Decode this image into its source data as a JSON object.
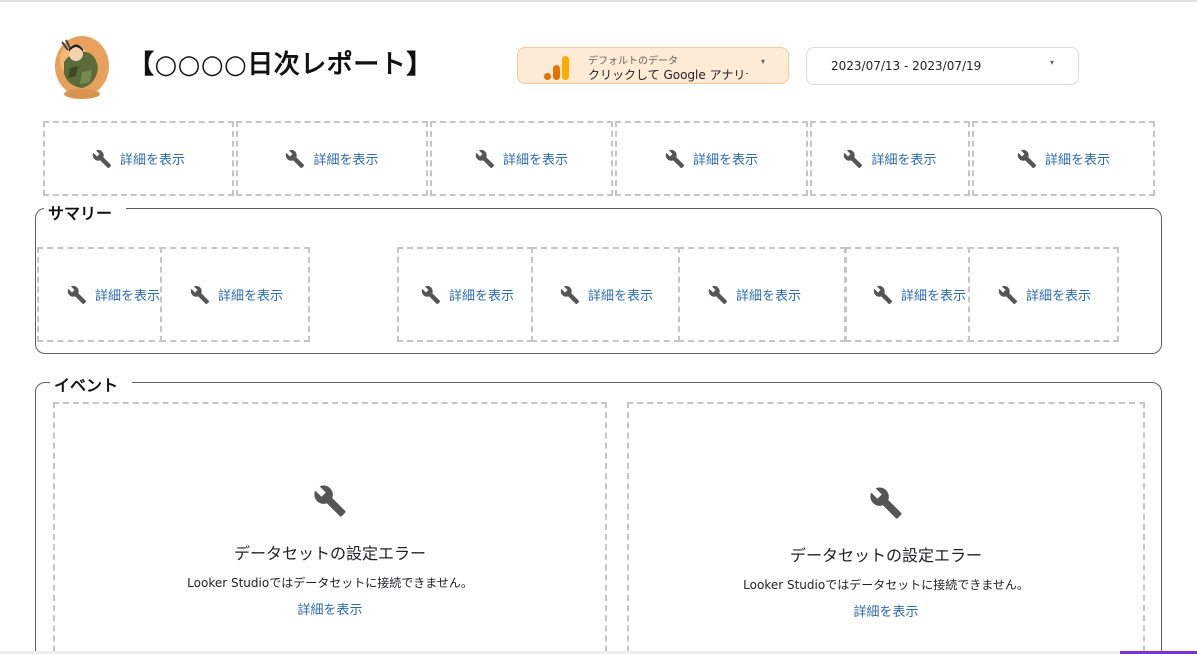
{
  "header": {
    "title": "【○○○○日次レポート】",
    "logo_icon": "character-logo-icon",
    "data_source": {
      "label": "デフォルトのデータ",
      "value": "クリックして Google アナリティクス",
      "icon": "analytics-icon",
      "caret": "▾"
    },
    "date_range": {
      "value": "2023/07/13 - 2023/07/19",
      "caret": "▾"
    }
  },
  "top_row": {
    "widgets": [
      {
        "link": "詳細を表示"
      },
      {
        "link": "詳細を表示"
      },
      {
        "link": "詳細を表示"
      },
      {
        "link": "詳細を表示"
      },
      {
        "link": "詳細を表示"
      },
      {
        "link": "詳細を表示"
      }
    ]
  },
  "summary": {
    "title": "サマリー",
    "widgets": [
      {
        "link": "詳細を表示"
      },
      {
        "link": "詳細を表示"
      },
      {
        "link": "詳細を表示"
      },
      {
        "link": "詳細を表示"
      },
      {
        "link": "詳細を表示"
      },
      {
        "link": "詳細を表示"
      },
      {
        "link": "詳細を表示"
      }
    ]
  },
  "events": {
    "title": "イベント",
    "errors": [
      {
        "title": "データセットの設定エラー",
        "description": "Looker Studioではデータセットに接続できません。",
        "link": "詳細を表示"
      },
      {
        "title": "データセットの設定エラー",
        "description": "Looker Studioではデータセットに接続できません。",
        "link": "詳細を表示"
      }
    ]
  },
  "colors": {
    "link": "#2b6cb0",
    "data_source_bg": "#fdebd6",
    "analytics_orange": "#f9ab00",
    "analytics_dark_orange": "#e37400",
    "placeholder_border": "#c5c5c5",
    "accent_purple": "#7b2fd6"
  }
}
